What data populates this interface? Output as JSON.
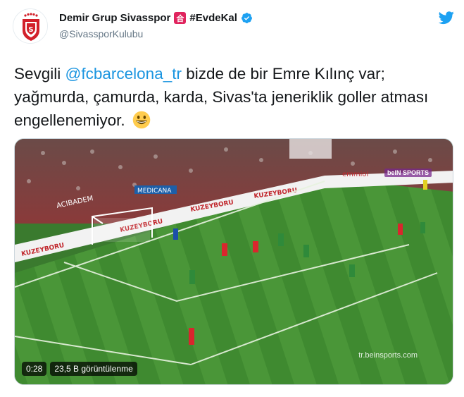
{
  "account": {
    "display_name": "Demir Grup Sivasspor",
    "badge_glyph": "合",
    "hashtag": "#EvdeKal",
    "handle": "@SivassporKulubu",
    "avatar_icon": "sivasspor-logo",
    "verified_icon": "verified-badge",
    "brand_icon": "twitter-bird"
  },
  "tweet": {
    "text_before_mention": "Sevgili ",
    "mention": "@fcbarcelona_tr",
    "text_after_mention": " bizde de bir Emre Kılınç var; yağmurda, çamurda, karda, Sivas'ta jeneriklik goller atması engellenemiyor.",
    "emoji": "grinning-face"
  },
  "media": {
    "watermark": "tr.beinsports.com",
    "broadcaster": "beIN SPORTS",
    "ads": [
      "KUZEYBORU",
      "KUZEYBORU",
      "KUZEYBORU",
      "ACIBADEM",
      "MEDICANA",
      "emmiol"
    ],
    "duration": "0:28",
    "views": "23,5 B görüntülenme"
  },
  "colors": {
    "mention": "#1b95e0",
    "verified": "#1da1f2",
    "pitch": "#3f8a30",
    "twitter": "#1da1f2"
  }
}
